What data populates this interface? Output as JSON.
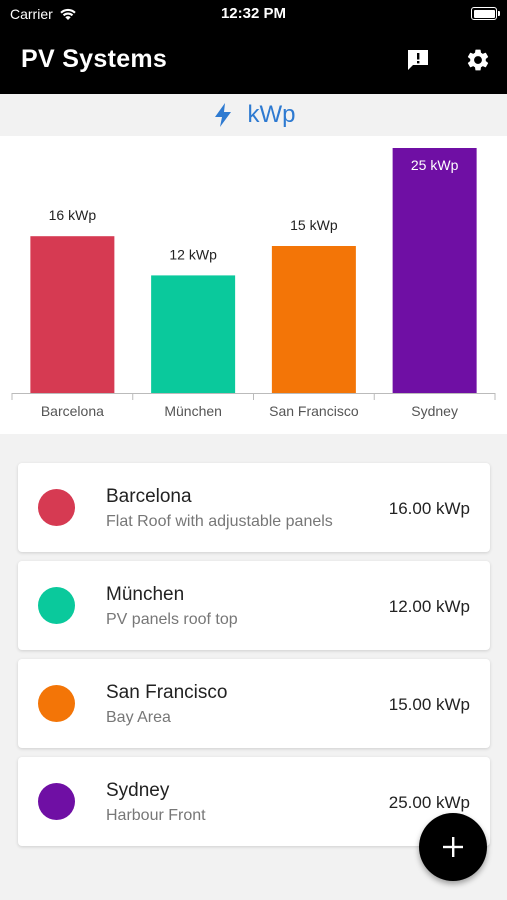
{
  "status_bar": {
    "carrier": "Carrier",
    "time": "12:32 PM"
  },
  "app_bar": {
    "title": "PV Systems",
    "icons": [
      "feedback-icon",
      "settings-icon"
    ]
  },
  "unit_header": {
    "icon": "lightning-bolt-icon",
    "label": "kWp"
  },
  "colors": {
    "accent": "#2e7ad1",
    "barcelona": "#d63a52",
    "muenchen": "#0ac99c",
    "san_francisco": "#f37507",
    "sydney": "#6f0fa4"
  },
  "chart_data": {
    "type": "bar",
    "categories": [
      "Barcelona",
      "München",
      "San Francisco",
      "Sydney"
    ],
    "values": [
      16,
      12,
      15,
      25
    ],
    "value_labels": [
      "16 kWp",
      "12 kWp",
      "15 kWp",
      "25 kWp"
    ],
    "colors": [
      "#d63a52",
      "#0ac99c",
      "#f37507",
      "#6f0fa4"
    ],
    "title": "",
    "xlabel": "",
    "ylabel": "",
    "ylim": [
      0,
      25
    ]
  },
  "systems": [
    {
      "name": "Barcelona",
      "description": "Flat Roof with adjustable panels",
      "power": "16.00 kWp",
      "color": "#d63a52"
    },
    {
      "name": "München",
      "description": "PV panels roof top",
      "power": "12.00 kWp",
      "color": "#0ac99c"
    },
    {
      "name": "San Francisco",
      "description": "Bay Area",
      "power": "15.00 kWp",
      "color": "#f37507"
    },
    {
      "name": "Sydney",
      "description": "Harbour Front",
      "power": "25.00 kWp",
      "color": "#6f0fa4"
    }
  ],
  "fab": {
    "icon": "plus-icon"
  }
}
